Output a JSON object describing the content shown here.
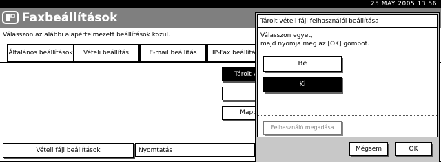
{
  "status": {
    "clock": "25 MAY  2005 13:56"
  },
  "header": {
    "title": "Faxbeállítások"
  },
  "main": {
    "instruction": "Válasszon az alábbi alapértelmezett beállítások közül.",
    "tabs": [
      {
        "label": "Általános beállítások"
      },
      {
        "label": "Vételi beállítás"
      },
      {
        "label": "E-mail beállítás"
      },
      {
        "label": "IP-Fax beállítás"
      }
    ],
    "side_buttons": [
      {
        "label": "Tárolt v"
      },
      {
        "label": ""
      },
      {
        "label": "Mapp"
      }
    ],
    "bottom": {
      "veteli_button": "Vételi fájl beállítások",
      "print_label": "Nyomtatás"
    }
  },
  "dialog": {
    "title": "Tárolt vételi fájl felhasználói beállítása",
    "prompt": "Válasszon egyet,\nmajd nyomja meg az [OK] gombot.",
    "options": [
      {
        "label": "Be",
        "selected": false
      },
      {
        "label": "Ki",
        "selected": true
      }
    ],
    "user_defined_button": "Felhasználó megadása",
    "cancel_label": "Mégsem",
    "ok_label": "OK"
  },
  "colors": {
    "header_bg": "#7f7f7f",
    "selected_bg": "#000000",
    "dialog_frame": "#c8c8c8"
  }
}
